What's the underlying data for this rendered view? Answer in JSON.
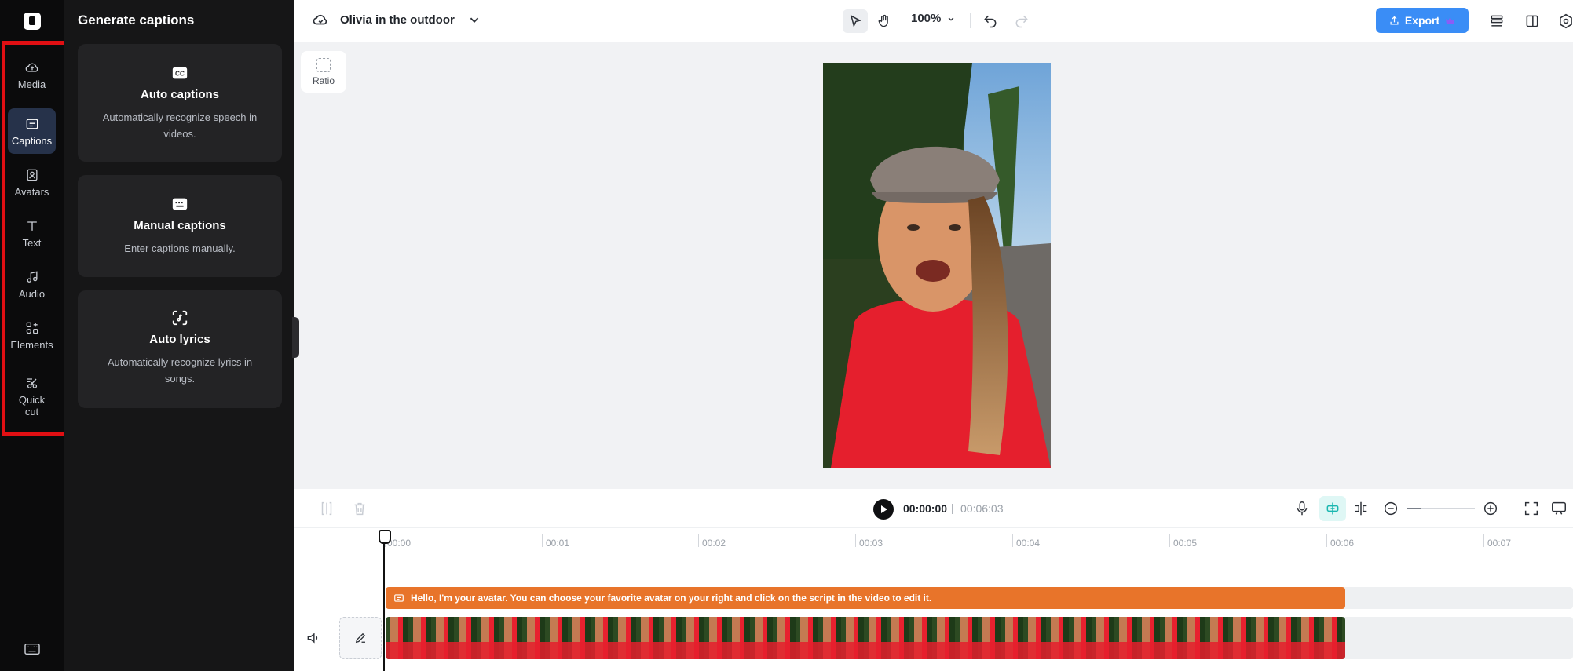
{
  "rail": {
    "items": [
      {
        "label": "Media",
        "icon": "cloud-upload-icon"
      },
      {
        "label": "Captions",
        "icon": "captions-icon",
        "active": true
      },
      {
        "label": "Avatars",
        "icon": "avatar-icon"
      },
      {
        "label": "Text",
        "icon": "text-icon"
      },
      {
        "label": "Audio",
        "icon": "music-note-icon"
      },
      {
        "label": "Elements",
        "icon": "elements-icon"
      },
      {
        "label": "Quick cut",
        "icon": "scissors-icon"
      }
    ]
  },
  "panel": {
    "title": "Generate captions",
    "cards": [
      {
        "title": "Auto captions",
        "desc": "Automatically recognize speech in videos."
      },
      {
        "title": "Manual captions",
        "desc": "Enter captions manually."
      },
      {
        "title": "Auto lyrics",
        "desc": "Automatically recognize lyrics in songs."
      }
    ]
  },
  "topbar": {
    "project_name": "Olivia in the outdoor",
    "zoom": "100%",
    "export_label": "Export"
  },
  "canvas": {
    "ratio_label": "Ratio"
  },
  "playback": {
    "current_time": "00:00:00",
    "separator": "|",
    "total_time": "00:06:03"
  },
  "timeline": {
    "ticks": [
      "00:00",
      "00:01",
      "00:02",
      "00:03",
      "00:04",
      "00:05",
      "00:06",
      "00:07"
    ],
    "caption_text": "Hello, I'm your avatar. You can choose your favorite avatar on your right and click on the script in the video to edit it."
  },
  "colors": {
    "accent": "#3a8df6",
    "caption_track": "#e8742a",
    "highlight": "#e10f13"
  }
}
